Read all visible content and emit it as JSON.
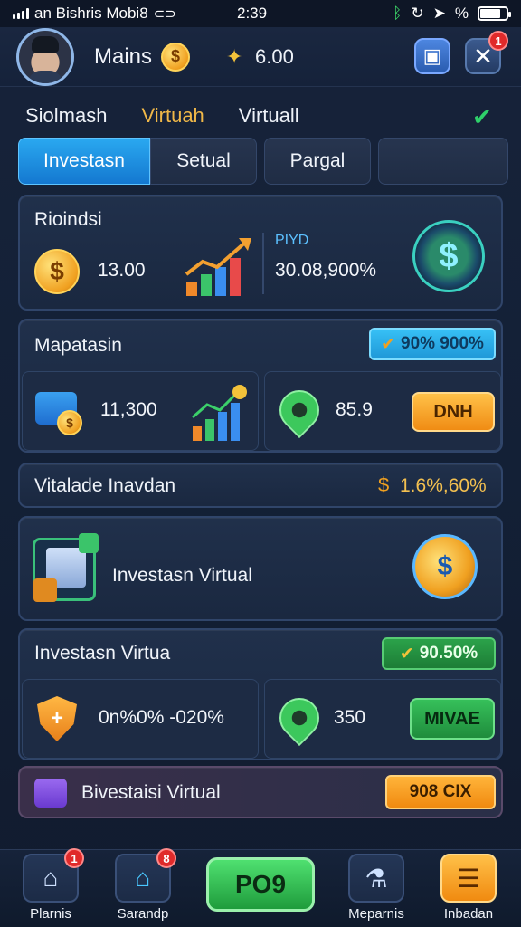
{
  "status_bar": {
    "carrier": "an Bishris Mobi8",
    "time": "2:39",
    "battery_text": "%"
  },
  "header": {
    "title": "Mains",
    "balance": "6.00",
    "notification_count": "1"
  },
  "top_tabs": [
    {
      "label": "Siolmash",
      "active": false
    },
    {
      "label": "Virtuah",
      "active": true
    },
    {
      "label": "Virtuall",
      "active": false
    }
  ],
  "segments": [
    {
      "label": "Investasn",
      "active": true
    },
    {
      "label": "Setual",
      "active": false
    },
    {
      "label": "Pargal",
      "active": false
    },
    {
      "label": "",
      "active": false
    }
  ],
  "card1": {
    "title": "Rioindsi",
    "amount": "13.00",
    "tag": "PIYD",
    "percent": "30.08,900%"
  },
  "card2": {
    "title": "Mapatasin",
    "pill": "90% 900%",
    "left_amount": "11,300",
    "right_value": "85.9",
    "button": "DNH"
  },
  "card3": {
    "title": "Vitalade Inavdan",
    "rate": "1.6%,60%"
  },
  "card4": {
    "title": "Investasn Virtual"
  },
  "card5": {
    "title": "Investasn Virtua",
    "pill": "90.50%",
    "left_value": "0n%0% -020%",
    "right_value": "350",
    "button": "MIVAE"
  },
  "card6": {
    "title": "Bivestaisi Virtual",
    "pill": "908 CIX"
  },
  "bottom_nav": [
    {
      "label": "Plarnis",
      "badge": "1"
    },
    {
      "label": "Sarandp",
      "badge": "8"
    },
    {
      "label": "PO9",
      "badge": ""
    },
    {
      "label": "Meparnis",
      "badge": ""
    },
    {
      "label": "Inbadan",
      "badge": ""
    }
  ],
  "colors": {
    "accent_blue": "#1f98d8",
    "accent_orange": "#f08a10",
    "accent_green": "#2ba24a",
    "active_tab": "#f0b848"
  }
}
